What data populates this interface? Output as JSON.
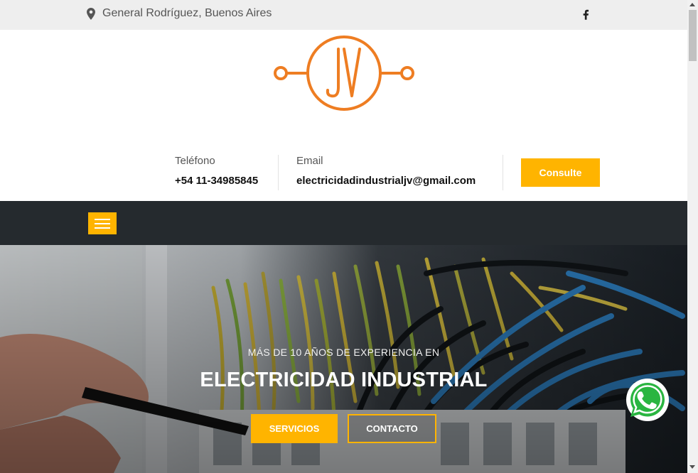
{
  "topbar": {
    "location": "General Rodríguez, Buenos Aires",
    "location_icon": "map-marker-icon",
    "social_icon": "facebook-icon"
  },
  "logo": {
    "text": "JV",
    "color": "#ee7d22"
  },
  "contact": {
    "phone_label": "Teléfono",
    "phone_value": "+54 11-34985845",
    "email_label": "Email",
    "email_value": "electricidadindustrialjv@gmail.com",
    "cta_label": "Consulte"
  },
  "nav": {
    "menu_icon": "hamburger-menu-icon"
  },
  "hero": {
    "subtitle": "MÁS DE 10 AÑOS DE EXPERIENCIA EN",
    "title": "ELECTRICIDAD INDUSTRIAL",
    "primary_button": "SERVICIOS",
    "secondary_button": "CONTACTO"
  },
  "floating": {
    "icon": "whatsapp-icon"
  },
  "colors": {
    "accent": "#ffb400",
    "nav_bg": "#252a2e",
    "topbar_bg": "#eeeeee",
    "whatsapp": "#2ab541"
  }
}
